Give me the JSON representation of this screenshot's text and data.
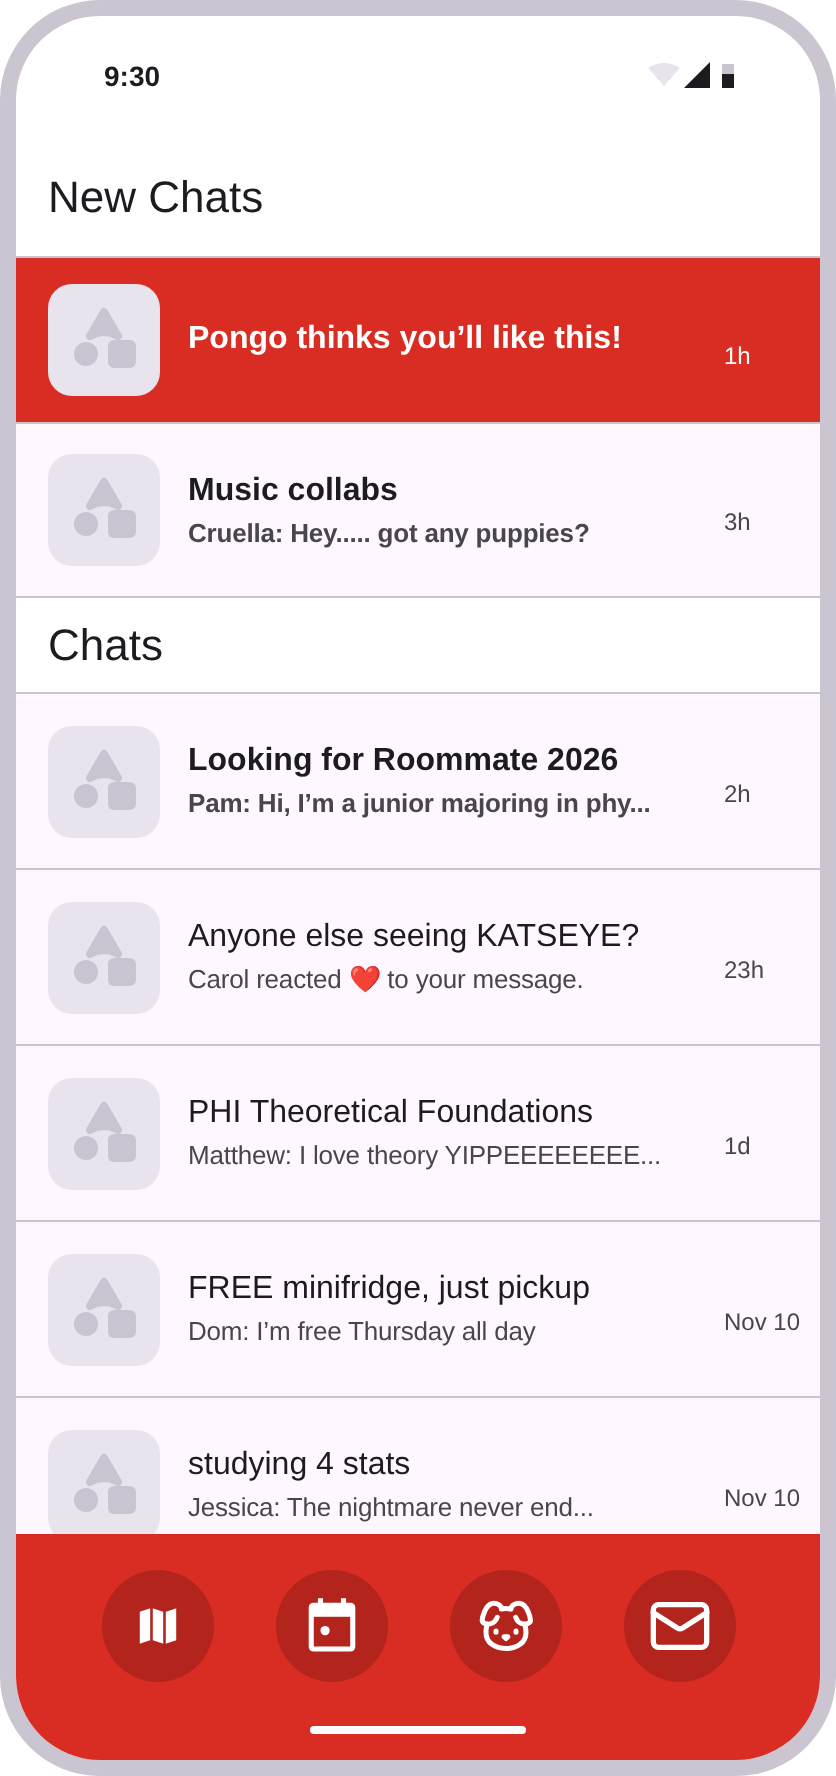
{
  "status_bar": {
    "time": "9:30"
  },
  "sections": [
    {
      "title": "New Chats",
      "chats": [
        {
          "title": "Pongo thinks you’ll like this!",
          "time": "1h",
          "highlighted": true,
          "unread": true
        },
        {
          "title": "Music collabs",
          "preview": "Cruella: Hey..... got any puppies?",
          "time": "3h",
          "highlighted": false,
          "unread": true
        }
      ]
    },
    {
      "title": "Chats",
      "chats": [
        {
          "title": "Looking for Roommate 2026",
          "preview": "Pam: Hi, I’m a junior majoring in phy...",
          "time": "2h",
          "highlighted": false,
          "unread": true
        },
        {
          "title": "Anyone else seeing KATSEYE?",
          "preview": "Carol reacted ❤️ to your message.",
          "time": "23h",
          "highlighted": false,
          "unread": false
        },
        {
          "title": "PHI Theoretical Foundations",
          "preview": "Matthew: I love theory YIPPEEEEEEEE...",
          "time": "1d",
          "highlighted": false,
          "unread": false
        },
        {
          "title": "FREE minifridge, just pickup",
          "preview": "Dom: I’m free Thursday all day",
          "time": "Nov 10",
          "highlighted": false,
          "unread": false
        },
        {
          "title": "studying 4 stats",
          "preview": "Jessica: The nightmare never end...",
          "time": "Nov 10",
          "highlighted": false,
          "unread": false
        }
      ]
    }
  ],
  "nav": [
    {
      "kind": "map"
    },
    {
      "kind": "calendar"
    },
    {
      "kind": "dog"
    },
    {
      "kind": "mail"
    }
  ]
}
